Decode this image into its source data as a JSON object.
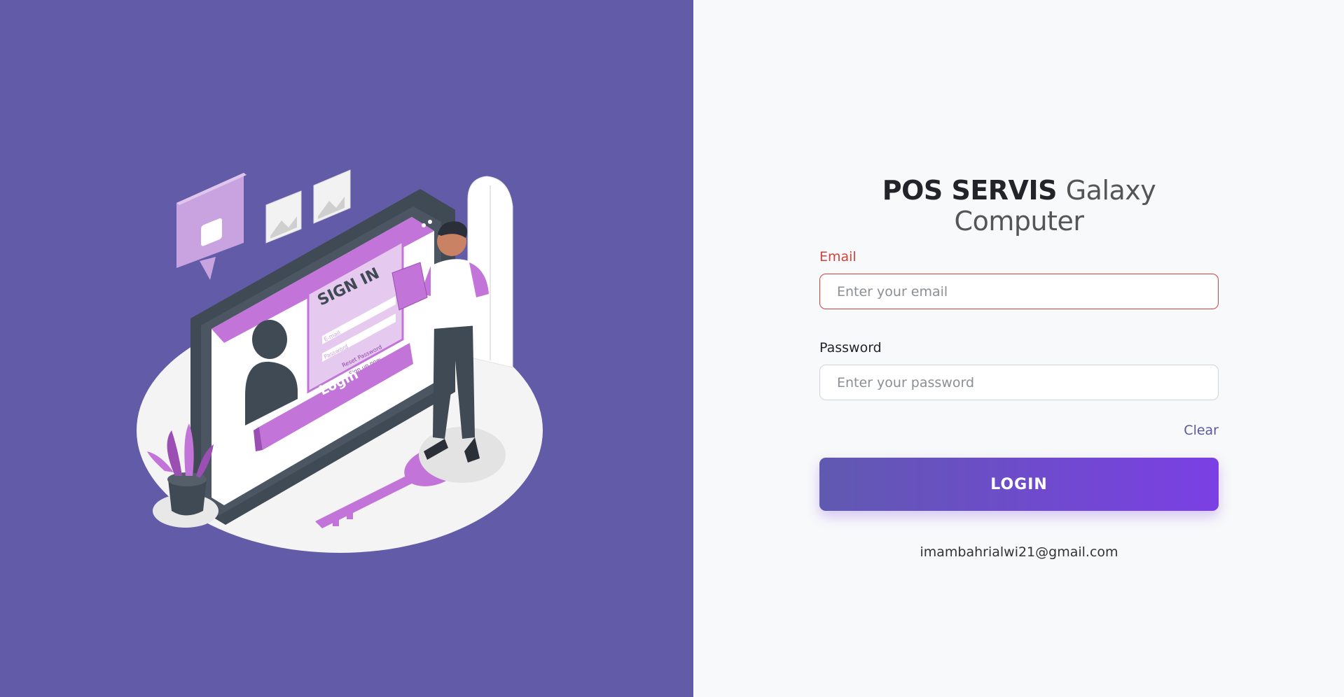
{
  "header": {
    "brand": "POS SERVIS",
    "subtitle": "Galaxy Computer"
  },
  "form": {
    "email_label": "Email",
    "email_placeholder": "Enter your email",
    "email_value": "",
    "password_label": "Password",
    "password_placeholder": "Enter your password",
    "password_value": "",
    "clear_label": "Clear",
    "login_label": "LOGIN"
  },
  "illustration": {
    "screen_heading": "SIGN IN",
    "field_email": "E-mail",
    "field_password": "Password",
    "reset_text": "Reset Password",
    "signup_text": "Sign up now",
    "button_text": "Login"
  },
  "footer": {
    "email": "imambahrialwi21@gmail.com"
  },
  "colors": {
    "left_panel": "#625ba8",
    "accent": "#7b3fe4",
    "error": "#d0413a",
    "purple_light": "#c274d8"
  }
}
